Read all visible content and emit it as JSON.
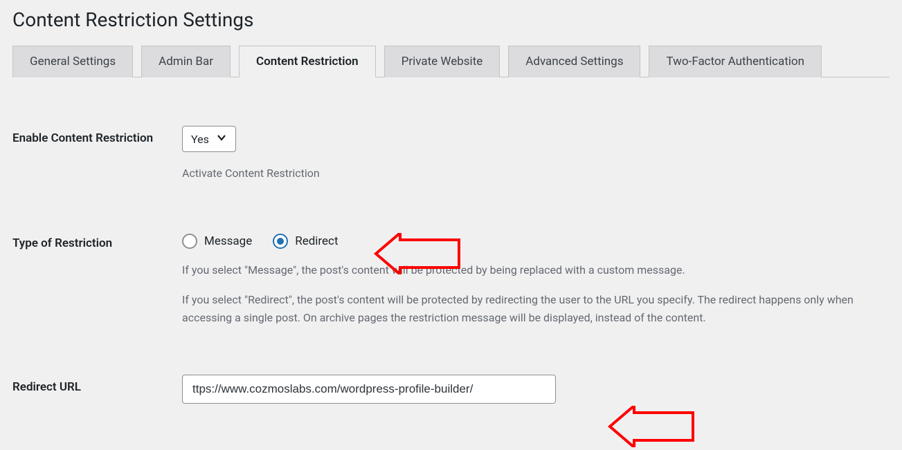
{
  "page": {
    "title": "Content Restriction Settings"
  },
  "tabs": [
    {
      "label": "General Settings"
    },
    {
      "label": "Admin Bar"
    },
    {
      "label": "Content Restriction"
    },
    {
      "label": "Private Website"
    },
    {
      "label": "Advanced Settings"
    },
    {
      "label": "Two-Factor Authentication"
    }
  ],
  "fields": {
    "enable": {
      "label": "Enable Content Restriction",
      "value": "Yes",
      "description": "Activate Content Restriction"
    },
    "type": {
      "label": "Type of Restriction",
      "options": {
        "message": "Message",
        "redirect": "Redirect"
      },
      "desc1": "If you select \"Message\", the post's content will be protected by being replaced with a custom message.",
      "desc2": "If you select \"Redirect\", the post's content will be protected by redirecting the user to the URL you specify. The redirect happens only when accessing a single post. On archive pages the restriction message will be displayed, instead of the content."
    },
    "redirect_url": {
      "label": "Redirect URL",
      "value": "ttps://www.cozmoslabs.com/wordpress-profile-builder/"
    }
  },
  "annotations": {
    "arrow_color": "#ff0000"
  }
}
